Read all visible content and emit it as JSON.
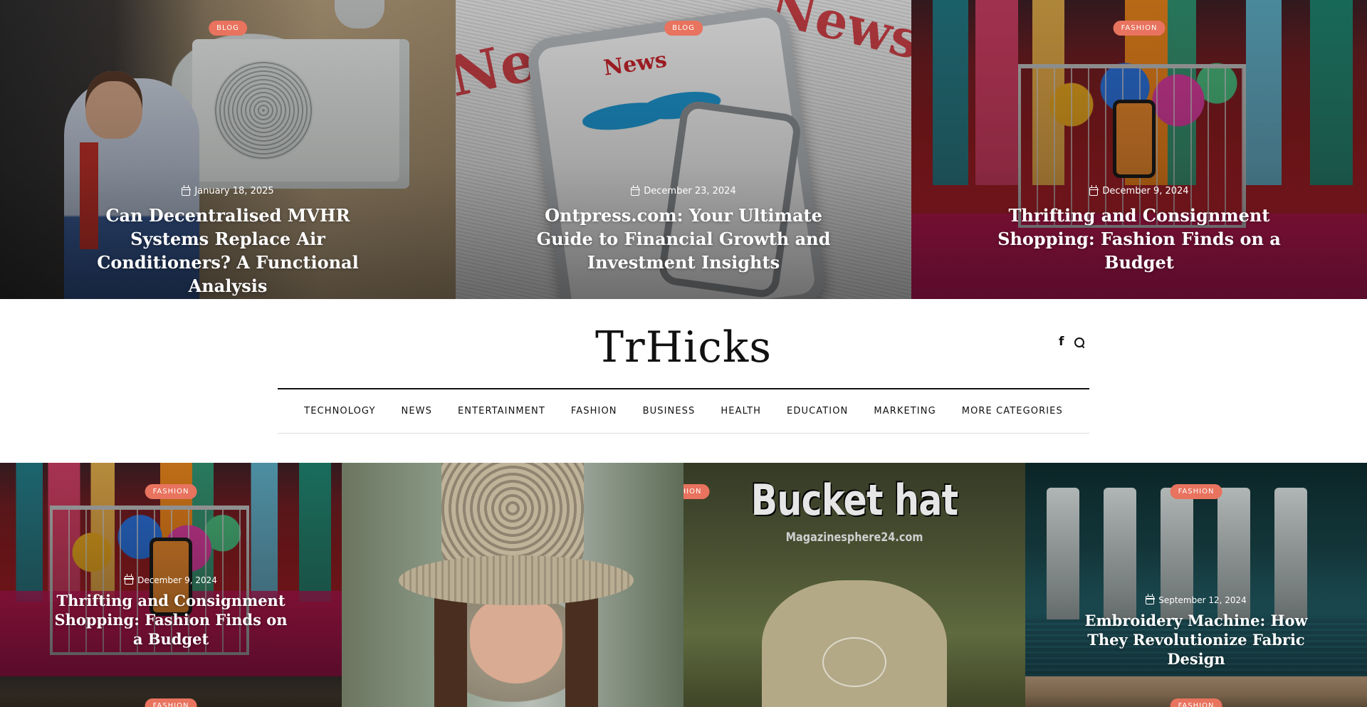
{
  "top_slider": [
    {
      "category": "BLOG",
      "date": "January 18, 2025",
      "title": "Can Decentralised MVHR Systems Replace Air Conditioners? A Functional Analysis"
    },
    {
      "category": "BLOG",
      "date": "December 23, 2024",
      "title": "Ontpress.com: Your Ultimate Guide to Financial Growth and Investment Insights"
    },
    {
      "category": "FASHION",
      "date": "December 9, 2024",
      "title": "Thrifting and Consignment Shopping: Fashion Finds on a Budget"
    }
  ],
  "header": {
    "logo": "TrHicks",
    "social_icon": "facebook-icon",
    "search_icon": "search-icon"
  },
  "nav": {
    "items": [
      "TECHNOLOGY",
      "NEWS",
      "ENTERTAINMENT",
      "FASHION",
      "BUSINESS",
      "HEALTH",
      "EDUCATION",
      "MARKETING",
      "MORE CATEGORIES"
    ]
  },
  "grid": [
    {
      "category": "FASHION",
      "date": "December 9, 2024",
      "title": "Thrifting and Consignment Shopping: Fashion Finds on a Budget"
    },
    {
      "category": "FASHION",
      "image_text": "Bucket hat",
      "image_subtext": "Magazinesphere24.com"
    },
    {
      "category": "FASHION",
      "date": "September 12, 2024",
      "title": "Embroidery Machine: How They Revolutionize Fabric Design"
    }
  ],
  "grid_partial": {
    "left_category": "FASHION",
    "right_category": "FASHION"
  },
  "colors": {
    "badge": "#e8735e",
    "nav_rule": "#111111"
  }
}
